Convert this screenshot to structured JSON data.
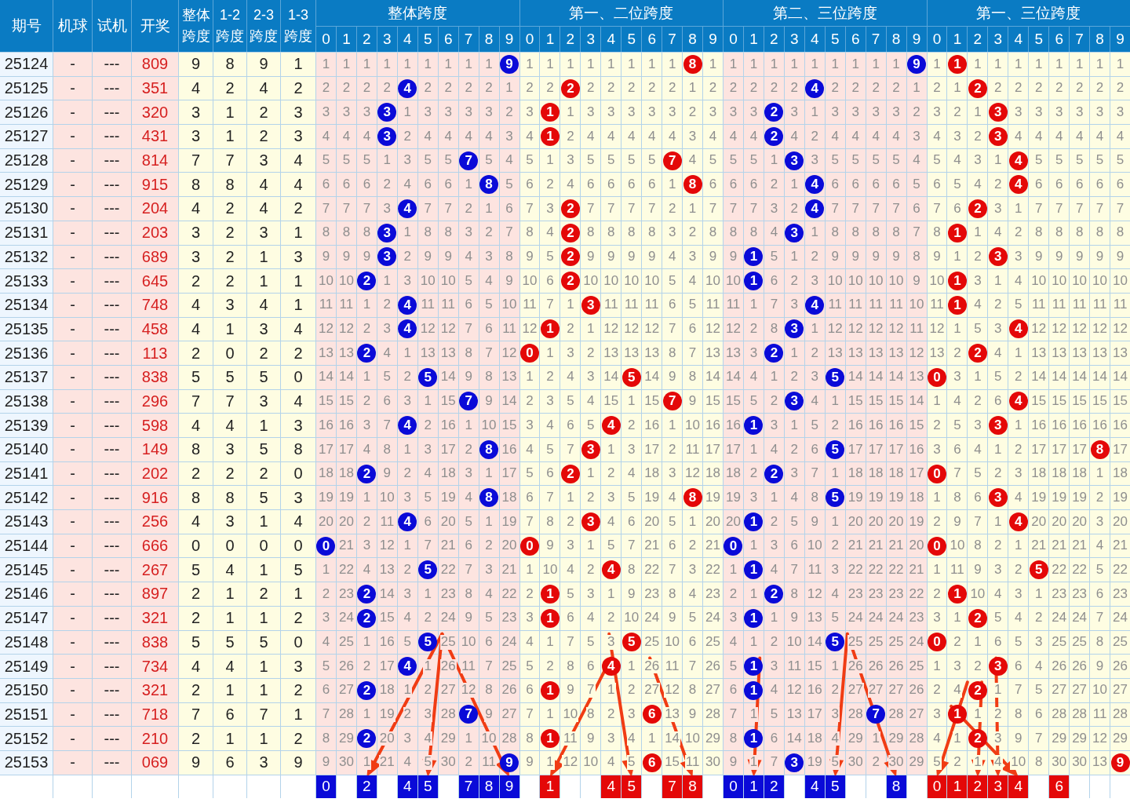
{
  "headers": [
    "期号",
    "机球",
    "试机",
    "开奖",
    "整体跨度",
    "1-2跨度",
    "2-3跨度",
    "1-3跨度"
  ],
  "groups": [
    {
      "title": "整体跨度",
      "color": "#0a0ad8",
      "columns": [
        "0",
        "1",
        "2",
        "3",
        "4",
        "5",
        "6",
        "7",
        "8",
        "9"
      ],
      "picks": [
        {
          "selected": true,
          "digit": "0"
        },
        {
          "selected": false
        },
        {
          "selected": true,
          "digit": "2"
        },
        {
          "selected": false
        },
        {
          "selected": true,
          "digit": "4"
        },
        {
          "selected": true,
          "digit": "5"
        },
        {
          "selected": false
        },
        {
          "selected": true,
          "digit": "7"
        },
        {
          "selected": true,
          "digit": "8"
        },
        {
          "selected": true,
          "digit": "9"
        }
      ]
    },
    {
      "title": "第一、二位跨度",
      "color": "#e40808",
      "columns": [
        "0",
        "1",
        "2",
        "3",
        "4",
        "5",
        "6",
        "7",
        "8",
        "9"
      ],
      "picks": [
        {
          "selected": false
        },
        {
          "selected": true,
          "digit": "1"
        },
        {
          "selected": false
        },
        {
          "selected": false
        },
        {
          "selected": true,
          "digit": "4"
        },
        {
          "selected": true,
          "digit": "5"
        },
        {
          "selected": false
        },
        {
          "selected": true,
          "digit": "7"
        },
        {
          "selected": true,
          "digit": "8"
        },
        {
          "selected": false
        }
      ]
    },
    {
      "title": "第二、三位跨度",
      "color": "#0a0ad8",
      "columns": [
        "0",
        "1",
        "2",
        "3",
        "4",
        "5",
        "6",
        "7",
        "8",
        "9"
      ],
      "picks": [
        {
          "selected": true,
          "digit": "0"
        },
        {
          "selected": true,
          "digit": "1"
        },
        {
          "selected": true,
          "digit": "2"
        },
        {
          "selected": false
        },
        {
          "selected": true,
          "digit": "4"
        },
        {
          "selected": true,
          "digit": "5"
        },
        {
          "selected": false
        },
        {
          "selected": false
        },
        {
          "selected": true,
          "digit": "8"
        },
        {
          "selected": false
        }
      ]
    },
    {
      "title": "第一、三位跨度",
      "color": "#e40808",
      "columns": [
        "0",
        "1",
        "2",
        "3",
        "4",
        "5",
        "6",
        "7",
        "8",
        "9"
      ],
      "picks": [
        {
          "selected": true,
          "digit": "0"
        },
        {
          "selected": true,
          "digit": "1"
        },
        {
          "selected": true,
          "digit": "2"
        },
        {
          "selected": true,
          "digit": "3"
        },
        {
          "selected": true,
          "digit": "4"
        },
        {
          "selected": false
        },
        {
          "selected": true,
          "digit": "6"
        },
        {
          "selected": false
        },
        {
          "selected": false
        },
        {
          "selected": false
        }
      ]
    }
  ],
  "rows": [
    {
      "issue": "25124",
      "ball": "-",
      "trial": "---",
      "draw": "809",
      "spans": [
        "9",
        "8",
        "9",
        "1"
      ],
      "cells": [
        [
          "1",
          "1",
          "1",
          "1",
          "1",
          "1",
          "1",
          "1",
          "1",
          {
            "hit": "9"
          }
        ],
        [
          "1",
          "1",
          "1",
          "1",
          "1",
          "1",
          "1",
          "1",
          {
            "hit": "8"
          },
          "1"
        ],
        [
          "1",
          "1",
          "1",
          "1",
          "1",
          "1",
          "1",
          "1",
          "1",
          {
            "hit": "9"
          }
        ],
        [
          "1",
          {
            "hit": "1"
          },
          "1",
          "1",
          "1",
          "1",
          "1",
          "1",
          "1",
          "1"
        ]
      ]
    },
    {
      "issue": "25125",
      "ball": "-",
      "trial": "---",
      "draw": "351",
      "spans": [
        "4",
        "2",
        "4",
        "2"
      ],
      "cells": [
        [
          "2",
          "2",
          "2",
          "2",
          {
            "hit": "4"
          },
          "2",
          "2",
          "2",
          "2",
          "1"
        ],
        [
          "2",
          "2",
          {
            "hit": "2"
          },
          "2",
          "2",
          "2",
          "2",
          "2",
          "1",
          "2"
        ],
        [
          "2",
          "2",
          "2",
          "2",
          {
            "hit": "4"
          },
          "2",
          "2",
          "2",
          "2",
          "1"
        ],
        [
          "2",
          "1",
          {
            "hit": "2"
          },
          "2",
          "2",
          "2",
          "2",
          "2",
          "2",
          "2"
        ]
      ]
    },
    {
      "issue": "25126",
      "ball": "-",
      "trial": "---",
      "draw": "320",
      "spans": [
        "3",
        "1",
        "2",
        "3"
      ],
      "cells": [
        [
          "3",
          "3",
          "3",
          {
            "hit": "3"
          },
          "1",
          "3",
          "3",
          "3",
          "3",
          "2"
        ],
        [
          "3",
          {
            "hit": "1"
          },
          "1",
          "3",
          "3",
          "3",
          "3",
          "3",
          "2",
          "3"
        ],
        [
          "3",
          "3",
          {
            "hit": "2"
          },
          "3",
          "1",
          "3",
          "3",
          "3",
          "3",
          "2"
        ],
        [
          "3",
          "2",
          "1",
          {
            "hit": "3"
          },
          "3",
          "3",
          "3",
          "3",
          "3",
          "3"
        ]
      ]
    },
    {
      "issue": "25127",
      "ball": "-",
      "trial": "---",
      "draw": "431",
      "spans": [
        "3",
        "1",
        "2",
        "3"
      ],
      "cells": [
        [
          "4",
          "4",
          "4",
          {
            "hit": "3"
          },
          "2",
          "4",
          "4",
          "4",
          "4",
          "3"
        ],
        [
          "4",
          {
            "hit": "1"
          },
          "2",
          "4",
          "4",
          "4",
          "4",
          "4",
          "3",
          "4"
        ],
        [
          "4",
          "4",
          {
            "hit": "2"
          },
          "4",
          "2",
          "4",
          "4",
          "4",
          "4",
          "3"
        ],
        [
          "4",
          "3",
          "2",
          {
            "hit": "3"
          },
          "4",
          "4",
          "4",
          "4",
          "4",
          "4"
        ]
      ]
    },
    {
      "issue": "25128",
      "ball": "-",
      "trial": "---",
      "draw": "814",
      "spans": [
        "7",
        "7",
        "3",
        "4"
      ],
      "cells": [
        [
          "5",
          "5",
          "5",
          "1",
          "3",
          "5",
          "5",
          {
            "hit": "7"
          },
          "5",
          "4"
        ],
        [
          "5",
          "1",
          "3",
          "5",
          "5",
          "5",
          "5",
          {
            "hit": "7"
          },
          "4",
          "5"
        ],
        [
          "5",
          "5",
          "1",
          {
            "hit": "3"
          },
          "3",
          "5",
          "5",
          "5",
          "5",
          "4"
        ],
        [
          "5",
          "4",
          "3",
          "1",
          {
            "hit": "4"
          },
          "5",
          "5",
          "5",
          "5",
          "5"
        ]
      ]
    },
    {
      "issue": "25129",
      "ball": "-",
      "trial": "---",
      "draw": "915",
      "spans": [
        "8",
        "8",
        "4",
        "4"
      ],
      "cells": [
        [
          "6",
          "6",
          "6",
          "2",
          "4",
          "6",
          "6",
          "1",
          {
            "hit": "8"
          },
          "5"
        ],
        [
          "6",
          "2",
          "4",
          "6",
          "6",
          "6",
          "6",
          "1",
          {
            "hit": "8"
          },
          "6"
        ],
        [
          "6",
          "6",
          "2",
          "1",
          {
            "hit": "4"
          },
          "6",
          "6",
          "6",
          "6",
          "5"
        ],
        [
          "6",
          "5",
          "4",
          "2",
          {
            "hit": "4"
          },
          "6",
          "6",
          "6",
          "6",
          "6"
        ]
      ]
    },
    {
      "issue": "25130",
      "ball": "-",
      "trial": "---",
      "draw": "204",
      "spans": [
        "4",
        "2",
        "4",
        "2"
      ],
      "cells": [
        [
          "7",
          "7",
          "7",
          "3",
          {
            "hit": "4"
          },
          "7",
          "7",
          "2",
          "1",
          "6"
        ],
        [
          "7",
          "3",
          {
            "hit": "2"
          },
          "7",
          "7",
          "7",
          "7",
          "2",
          "1",
          "7"
        ],
        [
          "7",
          "7",
          "3",
          "2",
          {
            "hit": "4"
          },
          "7",
          "7",
          "7",
          "7",
          "6"
        ],
        [
          "7",
          "6",
          {
            "hit": "2"
          },
          "3",
          "1",
          "7",
          "7",
          "7",
          "7",
          "7"
        ]
      ]
    },
    {
      "issue": "25131",
      "ball": "-",
      "trial": "---",
      "draw": "203",
      "spans": [
        "3",
        "2",
        "3",
        "1"
      ],
      "cells": [
        [
          "8",
          "8",
          "8",
          {
            "hit": "3"
          },
          "1",
          "8",
          "8",
          "3",
          "2",
          "7"
        ],
        [
          "8",
          "4",
          {
            "hit": "2"
          },
          "8",
          "8",
          "8",
          "8",
          "3",
          "2",
          "8"
        ],
        [
          "8",
          "8",
          "4",
          {
            "hit": "3"
          },
          "1",
          "8",
          "8",
          "8",
          "8",
          "7"
        ],
        [
          "8",
          {
            "hit": "1"
          },
          "1",
          "4",
          "2",
          "8",
          "8",
          "8",
          "8",
          "8"
        ]
      ]
    },
    {
      "issue": "25132",
      "ball": "-",
      "trial": "---",
      "draw": "689",
      "spans": [
        "3",
        "2",
        "1",
        "3"
      ],
      "cells": [
        [
          "9",
          "9",
          "9",
          {
            "hit": "3"
          },
          "2",
          "9",
          "9",
          "4",
          "3",
          "8"
        ],
        [
          "9",
          "5",
          {
            "hit": "2"
          },
          "9",
          "9",
          "9",
          "9",
          "4",
          "3",
          "9"
        ],
        [
          "9",
          {
            "hit": "1"
          },
          "5",
          "1",
          "2",
          "9",
          "9",
          "9",
          "9",
          "8"
        ],
        [
          "9",
          "1",
          "2",
          {
            "hit": "3"
          },
          "3",
          "9",
          "9",
          "9",
          "9",
          "9"
        ]
      ]
    },
    {
      "issue": "25133",
      "ball": "-",
      "trial": "---",
      "draw": "645",
      "spans": [
        "2",
        "2",
        "1",
        "1"
      ],
      "cells": [
        [
          "10",
          "10",
          {
            "hit": "2"
          },
          "1",
          "3",
          "10",
          "10",
          "5",
          "4",
          "9"
        ],
        [
          "10",
          "6",
          {
            "hit": "2"
          },
          "10",
          "10",
          "10",
          "10",
          "5",
          "4",
          "10"
        ],
        [
          "10",
          {
            "hit": "1"
          },
          "6",
          "2",
          "3",
          "10",
          "10",
          "10",
          "10",
          "9"
        ],
        [
          "10",
          {
            "hit": "1"
          },
          "3",
          "1",
          "4",
          "10",
          "10",
          "10",
          "10",
          "10"
        ]
      ]
    },
    {
      "issue": "25134",
      "ball": "-",
      "trial": "---",
      "draw": "748",
      "spans": [
        "4",
        "3",
        "4",
        "1"
      ],
      "cells": [
        [
          "11",
          "11",
          "1",
          "2",
          {
            "hit": "4"
          },
          "11",
          "11",
          "6",
          "5",
          "10"
        ],
        [
          "11",
          "7",
          "1",
          {
            "hit": "3"
          },
          "11",
          "11",
          "11",
          "6",
          "5",
          "11"
        ],
        [
          "11",
          "1",
          "7",
          "3",
          {
            "hit": "4"
          },
          "11",
          "11",
          "11",
          "11",
          "10"
        ],
        [
          "11",
          {
            "hit": "1"
          },
          "4",
          "2",
          "5",
          "11",
          "11",
          "11",
          "11",
          "11"
        ]
      ]
    },
    {
      "issue": "25135",
      "ball": "-",
      "trial": "---",
      "draw": "458",
      "spans": [
        "4",
        "1",
        "3",
        "4"
      ],
      "cells": [
        [
          "12",
          "12",
          "2",
          "3",
          {
            "hit": "4"
          },
          "12",
          "12",
          "7",
          "6",
          "11"
        ],
        [
          "12",
          {
            "hit": "1"
          },
          "2",
          "1",
          "12",
          "12",
          "12",
          "7",
          "6",
          "12"
        ],
        [
          "12",
          "2",
          "8",
          {
            "hit": "3"
          },
          "1",
          "12",
          "12",
          "12",
          "12",
          "11"
        ],
        [
          "12",
          "1",
          "5",
          "3",
          {
            "hit": "4"
          },
          "12",
          "12",
          "12",
          "12",
          "12"
        ]
      ]
    },
    {
      "issue": "25136",
      "ball": "-",
      "trial": "---",
      "draw": "113",
      "spans": [
        "2",
        "0",
        "2",
        "2"
      ],
      "cells": [
        [
          "13",
          "13",
          {
            "hit": "2"
          },
          "4",
          "1",
          "13",
          "13",
          "8",
          "7",
          "12"
        ],
        [
          {
            "hit": "0"
          },
          "1",
          "3",
          "2",
          "13",
          "13",
          "13",
          "8",
          "7",
          "13"
        ],
        [
          "13",
          "3",
          {
            "hit": "2"
          },
          "1",
          "2",
          "13",
          "13",
          "13",
          "13",
          "12"
        ],
        [
          "13",
          "2",
          {
            "hit": "2"
          },
          "4",
          "1",
          "13",
          "13",
          "13",
          "13",
          "13"
        ]
      ]
    },
    {
      "issue": "25137",
      "ball": "-",
      "trial": "---",
      "draw": "838",
      "spans": [
        "5",
        "5",
        "5",
        "0"
      ],
      "cells": [
        [
          "14",
          "14",
          "1",
          "5",
          "2",
          {
            "hit": "5"
          },
          "14",
          "9",
          "8",
          "13"
        ],
        [
          "1",
          "2",
          "4",
          "3",
          "14",
          {
            "hit": "5"
          },
          "14",
          "9",
          "8",
          "14"
        ],
        [
          "14",
          "4",
          "1",
          "2",
          "3",
          {
            "hit": "5"
          },
          "14",
          "14",
          "14",
          "13"
        ],
        [
          {
            "hit": "0"
          },
          "3",
          "1",
          "5",
          "2",
          "14",
          "14",
          "14",
          "14",
          "14"
        ]
      ]
    },
    {
      "issue": "25138",
      "ball": "-",
      "trial": "---",
      "draw": "296",
      "spans": [
        "7",
        "7",
        "3",
        "4"
      ],
      "cells": [
        [
          "15",
          "15",
          "2",
          "6",
          "3",
          "1",
          "15",
          {
            "hit": "7"
          },
          "9",
          "14"
        ],
        [
          "2",
          "3",
          "5",
          "4",
          "15",
          "1",
          "15",
          {
            "hit": "7"
          },
          "9",
          "15"
        ],
        [
          "15",
          "5",
          "2",
          {
            "hit": "3"
          },
          "4",
          "1",
          "15",
          "15",
          "15",
          "14"
        ],
        [
          "1",
          "4",
          "2",
          "6",
          {
            "hit": "4"
          },
          "15",
          "15",
          "15",
          "15",
          "15"
        ]
      ]
    },
    {
      "issue": "25139",
      "ball": "-",
      "trial": "---",
      "draw": "598",
      "spans": [
        "4",
        "4",
        "1",
        "3"
      ],
      "cells": [
        [
          "16",
          "16",
          "3",
          "7",
          {
            "hit": "4"
          },
          "2",
          "16",
          "1",
          "10",
          "15"
        ],
        [
          "3",
          "4",
          "6",
          "5",
          {
            "hit": "4"
          },
          "2",
          "16",
          "1",
          "10",
          "16"
        ],
        [
          "16",
          {
            "hit": "1"
          },
          "3",
          "1",
          "5",
          "2",
          "16",
          "16",
          "16",
          "15"
        ],
        [
          "2",
          "5",
          "3",
          {
            "hit": "3"
          },
          "1",
          "16",
          "16",
          "16",
          "16",
          "16"
        ]
      ]
    },
    {
      "issue": "25140",
      "ball": "-",
      "trial": "---",
      "draw": "149",
      "spans": [
        "8",
        "3",
        "5",
        "8"
      ],
      "cells": [
        [
          "17",
          "17",
          "4",
          "8",
          "1",
          "3",
          "17",
          "2",
          {
            "hit": "8"
          },
          "16"
        ],
        [
          "4",
          "5",
          "7",
          {
            "hit": "3"
          },
          "1",
          "3",
          "17",
          "2",
          "11",
          "17"
        ],
        [
          "17",
          "1",
          "4",
          "2",
          "6",
          {
            "hit": "5"
          },
          "17",
          "17",
          "17",
          "16"
        ],
        [
          "3",
          "6",
          "4",
          "1",
          "2",
          "17",
          "17",
          "17",
          {
            "hit": "8"
          },
          "17"
        ]
      ]
    },
    {
      "issue": "25141",
      "ball": "-",
      "trial": "---",
      "draw": "202",
      "spans": [
        "2",
        "2",
        "2",
        "0"
      ],
      "cells": [
        [
          "18",
          "18",
          {
            "hit": "2"
          },
          "9",
          "2",
          "4",
          "18",
          "3",
          "1",
          "17"
        ],
        [
          "5",
          "6",
          {
            "hit": "2"
          },
          "1",
          "2",
          "4",
          "18",
          "3",
          "12",
          "18"
        ],
        [
          "18",
          "2",
          {
            "hit": "2"
          },
          "3",
          "7",
          "1",
          "18",
          "18",
          "18",
          "17"
        ],
        [
          {
            "hit": "0"
          },
          "7",
          "5",
          "2",
          "3",
          "18",
          "18",
          "18",
          "1",
          "18"
        ]
      ]
    },
    {
      "issue": "25142",
      "ball": "-",
      "trial": "---",
      "draw": "916",
      "spans": [
        "8",
        "8",
        "5",
        "3"
      ],
      "cells": [
        [
          "19",
          "19",
          "1",
          "10",
          "3",
          "5",
          "19",
          "4",
          {
            "hit": "8"
          },
          "18"
        ],
        [
          "6",
          "7",
          "1",
          "2",
          "3",
          "5",
          "19",
          "4",
          {
            "hit": "8"
          },
          "19"
        ],
        [
          "19",
          "3",
          "1",
          "4",
          "8",
          {
            "hit": "5"
          },
          "19",
          "19",
          "19",
          "18"
        ],
        [
          "1",
          "8",
          "6",
          {
            "hit": "3"
          },
          "4",
          "19",
          "19",
          "19",
          "2",
          "19"
        ]
      ]
    },
    {
      "issue": "25143",
      "ball": "-",
      "trial": "---",
      "draw": "256",
      "spans": [
        "4",
        "3",
        "1",
        "4"
      ],
      "cells": [
        [
          "20",
          "20",
          "2",
          "11",
          {
            "hit": "4"
          },
          "6",
          "20",
          "5",
          "1",
          "19"
        ],
        [
          "7",
          "8",
          "2",
          {
            "hit": "3"
          },
          "4",
          "6",
          "20",
          "5",
          "1",
          "20"
        ],
        [
          "20",
          {
            "hit": "1"
          },
          "2",
          "5",
          "9",
          "1",
          "20",
          "20",
          "20",
          "19"
        ],
        [
          "2",
          "9",
          "7",
          "1",
          {
            "hit": "4"
          },
          "20",
          "20",
          "20",
          "3",
          "20"
        ]
      ]
    },
    {
      "issue": "25144",
      "ball": "-",
      "trial": "---",
      "draw": "666",
      "spans": [
        "0",
        "0",
        "0",
        "0"
      ],
      "cells": [
        [
          {
            "hit": "0"
          },
          "21",
          "3",
          "12",
          "1",
          "7",
          "21",
          "6",
          "2",
          "20"
        ],
        [
          {
            "hit": "0"
          },
          "9",
          "3",
          "1",
          "5",
          "7",
          "21",
          "6",
          "2",
          "21"
        ],
        [
          {
            "hit": "0"
          },
          "1",
          "3",
          "6",
          "10",
          "2",
          "21",
          "21",
          "21",
          "20"
        ],
        [
          {
            "hit": "0"
          },
          "10",
          "8",
          "2",
          "1",
          "21",
          "21",
          "21",
          "4",
          "21"
        ]
      ]
    },
    {
      "issue": "25145",
      "ball": "-",
      "trial": "---",
      "draw": "267",
      "spans": [
        "5",
        "4",
        "1",
        "5"
      ],
      "cells": [
        [
          "1",
          "22",
          "4",
          "13",
          "2",
          {
            "hit": "5"
          },
          "22",
          "7",
          "3",
          "21"
        ],
        [
          "1",
          "10",
          "4",
          "2",
          {
            "hit": "4"
          },
          "8",
          "22",
          "7",
          "3",
          "22"
        ],
        [
          "1",
          {
            "hit": "1"
          },
          "4",
          "7",
          "11",
          "3",
          "22",
          "22",
          "22",
          "21"
        ],
        [
          "1",
          "11",
          "9",
          "3",
          "2",
          {
            "hit": "5"
          },
          "22",
          "22",
          "5",
          "22"
        ]
      ]
    },
    {
      "issue": "25146",
      "ball": "-",
      "trial": "---",
      "draw": "897",
      "spans": [
        "2",
        "1",
        "2",
        "1"
      ],
      "cells": [
        [
          "2",
          "23",
          {
            "hit": "2"
          },
          "14",
          "3",
          "1",
          "23",
          "8",
          "4",
          "22"
        ],
        [
          "2",
          {
            "hit": "1"
          },
          "5",
          "3",
          "1",
          "9",
          "23",
          "8",
          "4",
          "23"
        ],
        [
          "2",
          "1",
          {
            "hit": "2"
          },
          "8",
          "12",
          "4",
          "23",
          "23",
          "23",
          "22"
        ],
        [
          "2",
          {
            "hit": "1"
          },
          "10",
          "4",
          "3",
          "1",
          "23",
          "23",
          "6",
          "23"
        ]
      ]
    },
    {
      "issue": "25147",
      "ball": "-",
      "trial": "---",
      "draw": "321",
      "spans": [
        "2",
        "1",
        "1",
        "2"
      ],
      "cells": [
        [
          "3",
          "24",
          {
            "hit": "2"
          },
          "15",
          "4",
          "2",
          "24",
          "9",
          "5",
          "23"
        ],
        [
          "3",
          {
            "hit": "1"
          },
          "6",
          "4",
          "2",
          "10",
          "24",
          "9",
          "5",
          "24"
        ],
        [
          "3",
          {
            "hit": "1"
          },
          "1",
          "9",
          "13",
          "5",
          "24",
          "24",
          "24",
          "23"
        ],
        [
          "3",
          "1",
          {
            "hit": "2"
          },
          "5",
          "4",
          "2",
          "24",
          "24",
          "7",
          "24"
        ]
      ]
    },
    {
      "issue": "25148",
      "ball": "-",
      "trial": "---",
      "draw": "838",
      "spans": [
        "5",
        "5",
        "5",
        "0"
      ],
      "cells": [
        [
          "4",
          "25",
          "1",
          "16",
          "5",
          {
            "hit": "5"
          },
          "25",
          "10",
          "6",
          "24"
        ],
        [
          "4",
          "1",
          "7",
          "5",
          "3",
          {
            "hit": "5"
          },
          "25",
          "10",
          "6",
          "25"
        ],
        [
          "4",
          "1",
          "2",
          "10",
          "14",
          {
            "hit": "5"
          },
          "25",
          "25",
          "25",
          "24"
        ],
        [
          {
            "hit": "0"
          },
          "2",
          "1",
          "6",
          "5",
          "3",
          "25",
          "25",
          "8",
          "25"
        ]
      ]
    },
    {
      "issue": "25149",
      "ball": "-",
      "trial": "---",
      "draw": "734",
      "spans": [
        "4",
        "4",
        "1",
        "3"
      ],
      "cells": [
        [
          "5",
          "26",
          "2",
          "17",
          {
            "hit": "4"
          },
          "1",
          "26",
          "11",
          "7",
          "25"
        ],
        [
          "5",
          "2",
          "8",
          "6",
          {
            "hit": "4"
          },
          "1",
          "26",
          "11",
          "7",
          "26"
        ],
        [
          "5",
          {
            "hit": "1"
          },
          "3",
          "11",
          "15",
          "1",
          "26",
          "26",
          "26",
          "25"
        ],
        [
          "1",
          "3",
          "2",
          {
            "hit": "3"
          },
          "6",
          "4",
          "26",
          "26",
          "9",
          "26"
        ]
      ]
    },
    {
      "issue": "25150",
      "ball": "-",
      "trial": "---",
      "draw": "321",
      "spans": [
        "2",
        "1",
        "1",
        "2"
      ],
      "cells": [
        [
          "6",
          "27",
          {
            "hit": "2"
          },
          "18",
          "1",
          "2",
          "27",
          "12",
          "8",
          "26"
        ],
        [
          "6",
          {
            "hit": "1"
          },
          "9",
          "7",
          "1",
          "2",
          "27",
          "12",
          "8",
          "27"
        ],
        [
          "6",
          {
            "hit": "1"
          },
          "4",
          "12",
          "16",
          "2",
          "27",
          "27",
          "27",
          "26"
        ],
        [
          "2",
          "4",
          {
            "hit": "2"
          },
          "1",
          "7",
          "5",
          "27",
          "27",
          "10",
          "27"
        ]
      ]
    },
    {
      "issue": "25151",
      "ball": "-",
      "trial": "---",
      "draw": "718",
      "spans": [
        "7",
        "6",
        "7",
        "1"
      ],
      "cells": [
        [
          "7",
          "28",
          "1",
          "19",
          "2",
          "3",
          "28",
          {
            "hit": "7"
          },
          "9",
          "27"
        ],
        [
          "7",
          "1",
          "10",
          "8",
          "2",
          "3",
          {
            "hit": "6"
          },
          "13",
          "9",
          "28"
        ],
        [
          "7",
          "1",
          "5",
          "13",
          "17",
          "3",
          "28",
          {
            "hit": "7"
          },
          "28",
          "27"
        ],
        [
          "3",
          {
            "hit": "1"
          },
          "1",
          "2",
          "8",
          "6",
          "28",
          "28",
          "11",
          "28"
        ]
      ]
    },
    {
      "issue": "25152",
      "ball": "-",
      "trial": "---",
      "draw": "210",
      "spans": [
        "2",
        "1",
        "1",
        "2"
      ],
      "cells": [
        [
          "8",
          "29",
          {
            "hit": "2"
          },
          "20",
          "3",
          "4",
          "29",
          "1",
          "10",
          "28"
        ],
        [
          "8",
          {
            "hit": "1"
          },
          "11",
          "9",
          "3",
          "4",
          "1",
          "14",
          "10",
          "29"
        ],
        [
          "8",
          {
            "hit": "1"
          },
          "6",
          "14",
          "18",
          "4",
          "29",
          "1",
          "29",
          "28"
        ],
        [
          "4",
          "1",
          {
            "hit": "2"
          },
          "3",
          "9",
          "7",
          "29",
          "29",
          "12",
          "29"
        ]
      ]
    },
    {
      "issue": "25153",
      "ball": "-",
      "trial": "---",
      "draw": "069",
      "spans": [
        "9",
        "6",
        "3",
        "9"
      ],
      "cells": [
        [
          "9",
          "30",
          "1",
          "21",
          "4",
          "5",
          "30",
          "2",
          "11",
          {
            "hit": "9"
          }
        ],
        [
          "9",
          "1",
          "12",
          "10",
          "4",
          "5",
          {
            "hit": "6"
          },
          "15",
          "11",
          "30"
        ],
        [
          "9",
          "1",
          "7",
          {
            "hit": "3"
          },
          "19",
          "5",
          "30",
          "2",
          "30",
          "29"
        ],
        [
          "5",
          "2",
          "1",
          "4",
          "10",
          "8",
          "30",
          "30",
          "13",
          {
            "hit": "9"
          }
        ]
      ]
    }
  ]
}
